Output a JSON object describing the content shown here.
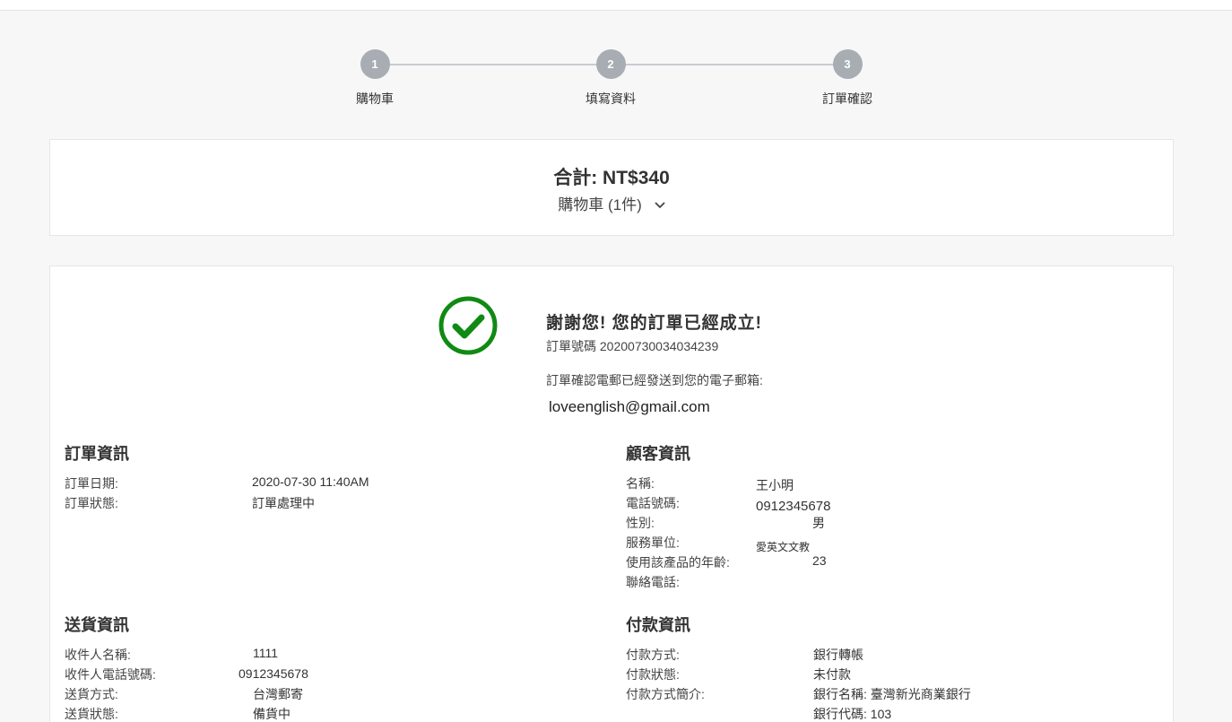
{
  "steps": [
    {
      "number": "1",
      "label": "購物車"
    },
    {
      "number": "2",
      "label": "填寫資料"
    },
    {
      "number": "3",
      "label": "訂單確認"
    }
  ],
  "summary": {
    "total": "合計: NT$340",
    "cart_toggle": "購物車 (1件)",
    "icon": "chevron-down-icon"
  },
  "confirmation": {
    "icon": "check-circle-icon",
    "icon_color": "#118a13",
    "heading": "謝謝您! 您的訂單已經成立!",
    "order_number": "訂單號碼 20200730034034239",
    "email_note": "訂單確認電郵已經發送到您的電子郵箱:",
    "email": "loveenglish@gmail.com"
  },
  "order_info": {
    "title": "訂單資訊",
    "rows": [
      {
        "label": "訂單日期:",
        "value": "2020-07-30 11:40AM"
      },
      {
        "label": "訂單狀態:",
        "value": "訂單處理中"
      }
    ]
  },
  "customer_info": {
    "title": "顧客資訊",
    "rows": [
      {
        "label": "名稱:",
        "value": "王小明"
      },
      {
        "label": "電話號碼:",
        "value": "0912345678"
      },
      {
        "label": "性別:",
        "value": "男"
      },
      {
        "label": "服務單位:",
        "value": "愛英文文教"
      },
      {
        "label": "使用該產品的年齡:",
        "value": "23"
      },
      {
        "label": "聯絡電話:",
        "value": ""
      }
    ]
  },
  "delivery_info": {
    "title": "送貨資訊",
    "rows": [
      {
        "label": "收件人名稱:",
        "value": "1111"
      },
      {
        "label": "收件人電話號碼:",
        "value": "0912345678"
      },
      {
        "label": "送貨方式:",
        "value": "台灣郵寄"
      },
      {
        "label": "送貨狀態:",
        "value": "備貨中"
      }
    ]
  },
  "payment_info": {
    "title": "付款資訊",
    "rows": [
      {
        "label": "付款方式:",
        "value": "銀行轉帳"
      },
      {
        "label": "付款狀態:",
        "value": "未付款"
      },
      {
        "label": "付款方式簡介:",
        "value": "銀行名稱: 臺灣新光商業銀行"
      },
      {
        "label": "",
        "value": "銀行代碼: 103"
      }
    ]
  }
}
